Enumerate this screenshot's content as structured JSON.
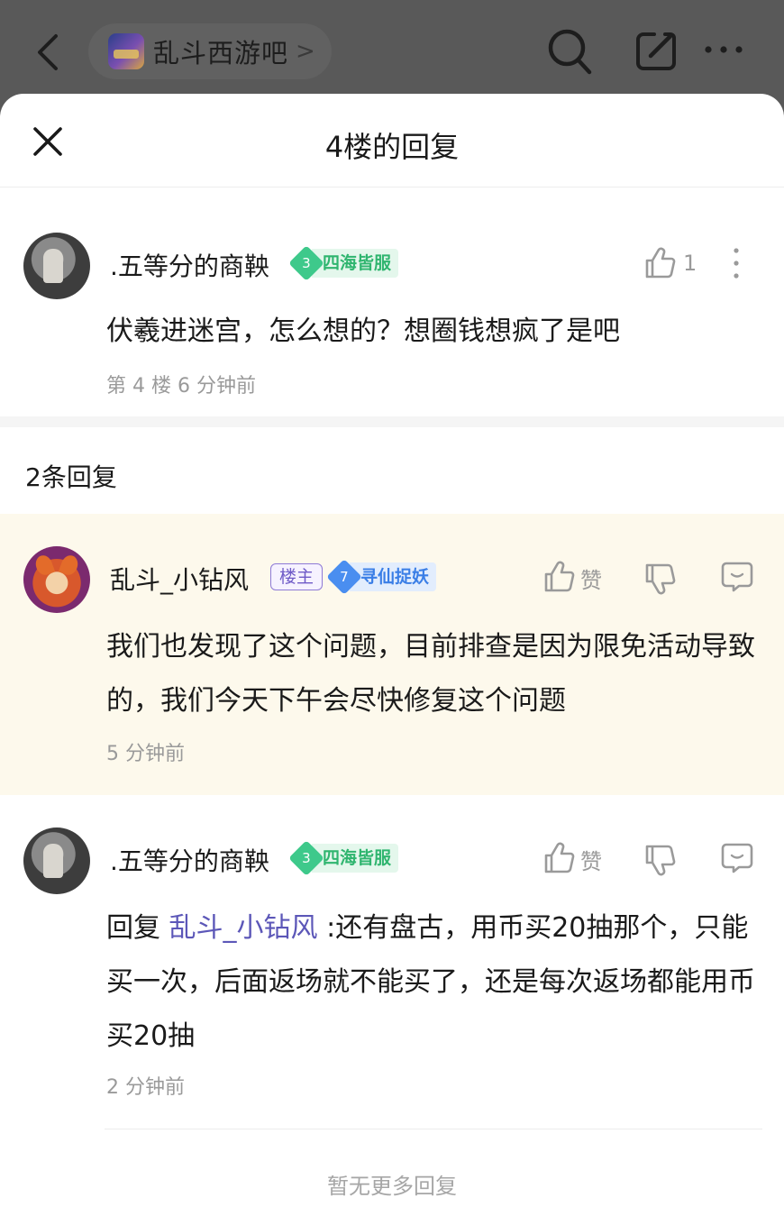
{
  "topbar": {
    "forum_name": "乱斗西游吧",
    "chevron": ">",
    "icons": [
      "back-icon",
      "search-icon",
      "edit-icon",
      "more-icon"
    ]
  },
  "sheet": {
    "title": "4楼的回复",
    "close_icon": "close-icon"
  },
  "floor_post": {
    "author": ".五等分的商鞅",
    "level": "3",
    "level_title": "四海皆服",
    "like_count": "1",
    "text": "伏羲进迷宫，怎么想的？想圈钱想疯了是吧",
    "meta": "第 4 楼   6 分钟前"
  },
  "reply_count_label": "2条回复",
  "replies": [
    {
      "author": "乱斗_小钻风",
      "owner_tag": "楼主",
      "level": "7",
      "level_title": "寻仙捉妖",
      "like_label": "赞",
      "text": "我们也发现了这个问题，目前排查是因为限免活动导致的，我们今天下午会尽快修复这个问题",
      "time": "5 分钟前",
      "highlighted": true
    },
    {
      "author": ".五等分的商鞅",
      "level": "3",
      "level_title": "四海皆服",
      "like_label": "赞",
      "reply_prefix": "回复 ",
      "reply_to": "乱斗_小钻风",
      "text": " :还有盘古，用币买20抽那个，只能买一次，后面返场就不能买了，还是每次返场都能用币买20抽",
      "time": "2 分钟前",
      "highlighted": false
    }
  ],
  "footer": {
    "no_more": "暂无更多回复"
  },
  "colors": {
    "link": "#5c57b8",
    "highlight_bg": "#fdf9ec",
    "level_green": "#3ec98b",
    "level_blue": "#4a8ef0",
    "meta_gray": "#9a9a9a"
  }
}
